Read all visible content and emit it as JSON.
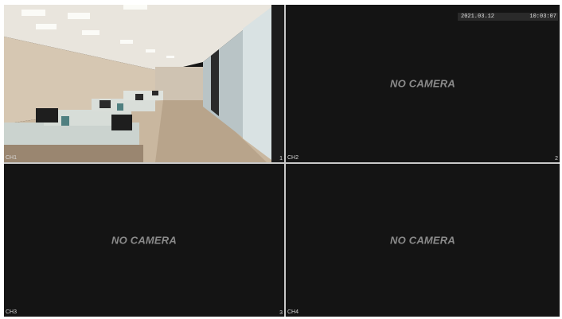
{
  "channels": [
    {
      "label": "CH1",
      "number": "1",
      "status": ""
    },
    {
      "label": "CH2",
      "number": "2",
      "status": "NO CAMERA"
    },
    {
      "label": "CH3",
      "number": "3",
      "status": "NO CAMERA"
    },
    {
      "label": "CH4",
      "number": "",
      "status": "NO CAMERA"
    }
  ],
  "timestamp": {
    "date": "2021.03.12",
    "time": "10:03:07"
  },
  "colors": {
    "background": "#141414",
    "grid": "#c9c9c9",
    "no_camera_text": "#8a8a8a"
  }
}
